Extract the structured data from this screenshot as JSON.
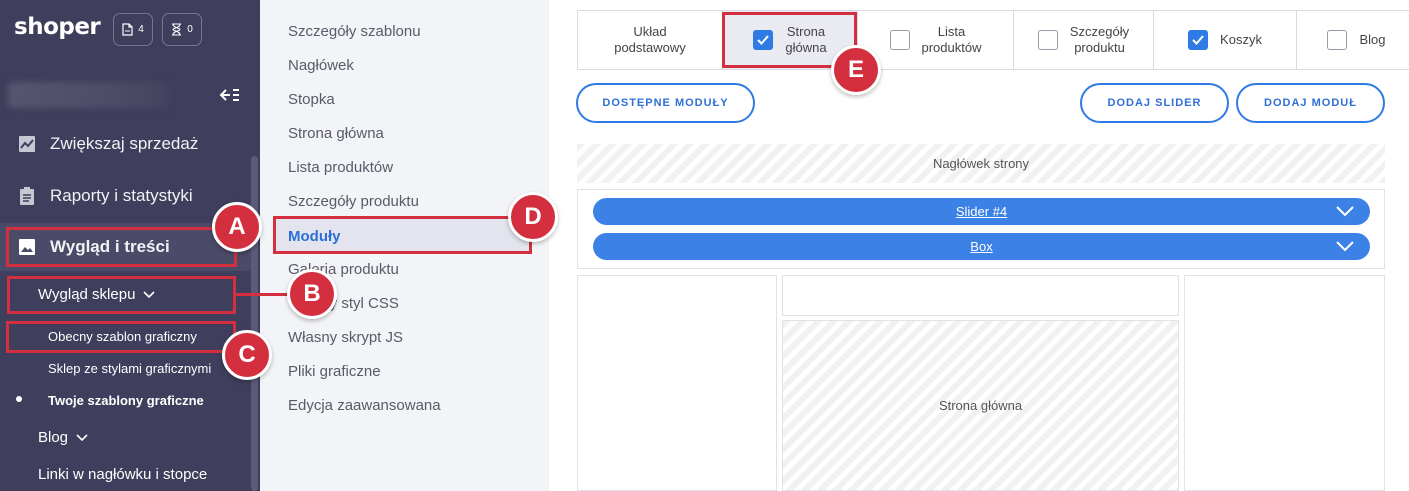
{
  "sidebar": {
    "logo": "shoper",
    "badges": [
      {
        "icon": "document-icon",
        "count": "4"
      },
      {
        "icon": "hourglass-icon",
        "count": "0"
      }
    ],
    "items": [
      {
        "label": "Zwiększaj sprzedaż",
        "icon": "chart-icon"
      },
      {
        "label": "Raporty i statystyki",
        "icon": "clipboard-icon"
      },
      {
        "label": "Wygląd i treści",
        "icon": "image-icon",
        "active": true
      }
    ],
    "sub": {
      "wyglad_sklepu": "Wygląd sklepu",
      "children": [
        "Obecny szablon graficzny",
        "Sklep ze stylami graficznymi",
        "Twoje szablony graficzne"
      ],
      "blog": "Blog",
      "links": "Linki w nagłówku i stopce"
    }
  },
  "middle_menu": {
    "items": [
      "Szczegóły szablonu",
      "Nagłówek",
      "Stopka",
      "Strona główna",
      "Lista produktów",
      "Szczegóły produktu",
      "Moduły",
      "Galeria produktu",
      "Własny styl CSS",
      "Własny skrypt JS",
      "Pliki graficzne",
      "Edycja zaawansowana"
    ],
    "active_index": 6
  },
  "content": {
    "tabs": [
      {
        "line1": "Układ",
        "line2": "podstawowy",
        "checkbox": false
      },
      {
        "line1": "Strona",
        "line2": "główna",
        "checkbox": true,
        "checked": true,
        "selected": true
      },
      {
        "line1": "Lista",
        "line2": "produktów",
        "checkbox": true,
        "checked": false
      },
      {
        "line1": "Szczegóły",
        "line2": "produktu",
        "checkbox": true,
        "checked": false
      },
      {
        "line1": "Koszyk",
        "line2": "",
        "checkbox": true,
        "checked": true
      },
      {
        "line1": "Blog",
        "line2": "",
        "checkbox": true,
        "checked": false
      }
    ],
    "buttons": {
      "available_modules": "DOSTĘPNE MODUŁY",
      "add_slider": "DODAJ SLIDER",
      "add_module": "DODAJ MODUŁ"
    },
    "header_zone": "Nagłówek strony",
    "pills": [
      "Slider #4",
      "Box"
    ],
    "main_zone": "Strona główna"
  },
  "annotations": {
    "labels": [
      "A",
      "B",
      "C",
      "D",
      "E"
    ],
    "color": "#d32f3f"
  },
  "colors": {
    "sidebar_bg": "#3f3e5c",
    "accent": "#2f7be6",
    "highlight": "#d32f3f"
  }
}
